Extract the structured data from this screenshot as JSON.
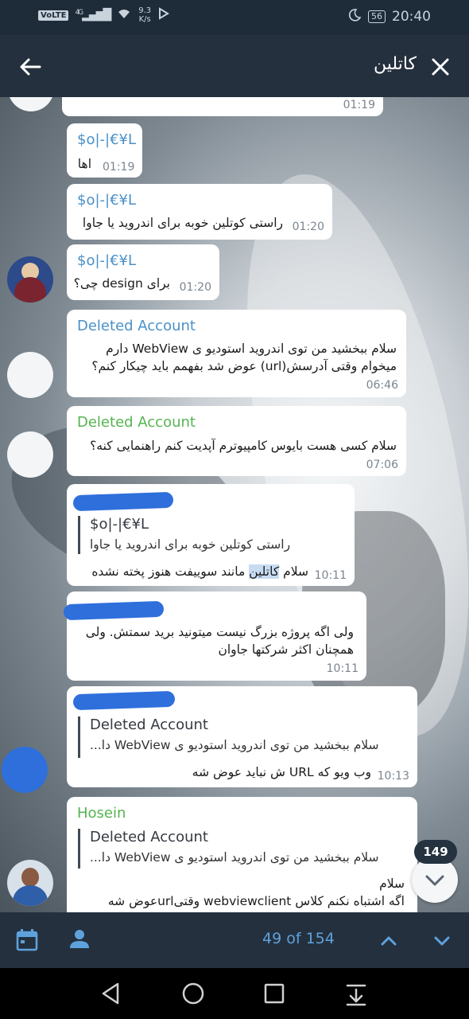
{
  "status_bar": {
    "network_badge": "VoLTE",
    "network_type": "4G",
    "speed_value": "9.3",
    "speed_unit": "K/s",
    "battery": "56",
    "time": "20:40"
  },
  "header": {
    "search_query": "کاتلین"
  },
  "messages": [
    {
      "time": "01:19"
    },
    {
      "sender": "$o|-|€¥L",
      "text": "اها",
      "time": "01:19"
    },
    {
      "sender": "$o|-|€¥L",
      "text": "راستی کوتلین خوبه برای اندروید یا جاوا",
      "time": "01:20"
    },
    {
      "sender": "$o|-|€¥L",
      "text": "برای design چی؟",
      "time": "01:20"
    },
    {
      "sender": "Deleted Account",
      "line1": "سلام ببخشید من توی اندروید استودیو ی WebView دارم",
      "line2": "میخوام وقتی آدرسش(url) عوض شد بفهمم باید چیکار کنم؟",
      "time": "06:46"
    },
    {
      "sender": "Deleted Account",
      "text": "سلام کسی هست بایوس کامپیوترم آپدیت کنم راهنمایی کنه؟",
      "time": "07:06"
    },
    {
      "quote_name": "$o|-|€¥L",
      "quote_text": "راستی کوتلین خوبه برای اندروید یا جاوا",
      "text_before": "سلام ",
      "highlight": "کاتلین",
      "text_after": " مانند سوییفت هنوز پخته نشده",
      "time": "10:11"
    },
    {
      "line1": "ولی اگه پروژه بزرگ نیست میتونید برید سمتش. ولی",
      "line2": "همچنان اکثر شرکتها جاوان",
      "time": "10:11"
    },
    {
      "quote_name": "Deleted Account",
      "quote_text": "سلام ببخشید من توی اندروید استودیو ی WebView دا...",
      "text": "وب ویو که URL ش نباید عوض شه",
      "time": "10:13"
    },
    {
      "sender": "Hosein",
      "quote_name": "Deleted Account",
      "quote_text": "سلام ببخشید من توی اندروید استودیو ی WebView دا...",
      "line1": "سلام",
      "line2": "اگه اشتباه نکنم کلاس webviewclient وقتیurlعوض شه"
    }
  ],
  "unread_badge": "149",
  "search_toolbar": {
    "counter": "49 of 154"
  },
  "icons": {
    "back": "arrow-left-icon",
    "close": "close-icon",
    "calendar": "calendar-icon",
    "user": "person-icon",
    "up": "chevron-up-icon",
    "down": "chevron-down-icon"
  },
  "colors": {
    "accent": "#5ea2dd",
    "name_blue": "#4a90c8",
    "name_green": "#55b450",
    "header_bg": "#24303d"
  }
}
